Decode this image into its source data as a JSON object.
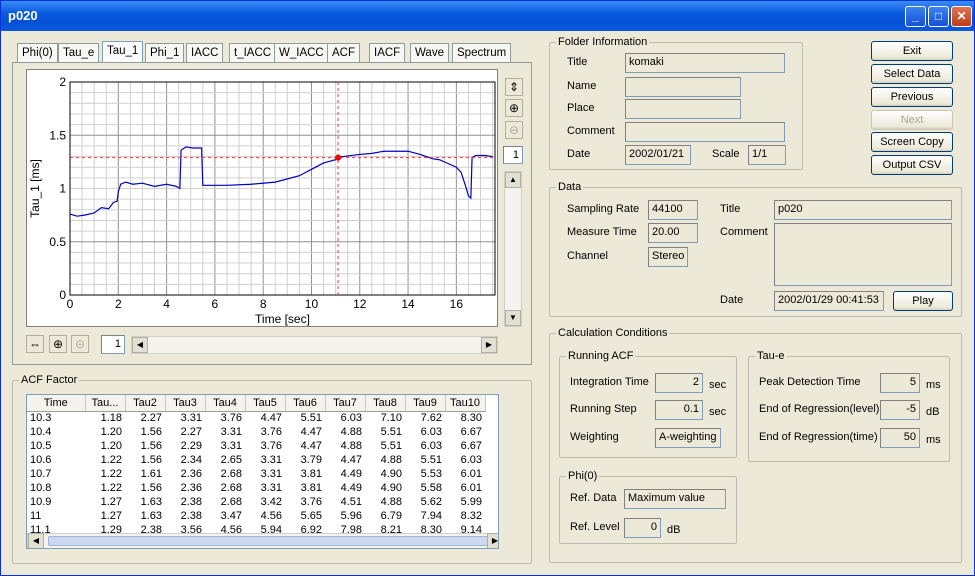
{
  "window": {
    "title": "p020"
  },
  "tabs": [
    "Phi(0)",
    "Tau_e",
    "Tau_1",
    "Phi_1",
    "IACC",
    "t_IACC",
    "W_IACC",
    "ACF",
    "IACF",
    "Wave",
    "Spectrum"
  ],
  "selected_tab": "Tau_1",
  "chart_data": {
    "type": "line",
    "xlabel": "Time [sec]",
    "ylabel": "Tau_1 [ms]",
    "xlim": [
      0,
      17.6
    ],
    "ylim": [
      0,
      2
    ],
    "xticks": [
      "0",
      "2",
      "4",
      "6",
      "8",
      "10",
      "12",
      "14",
      "16"
    ],
    "yticks": [
      "0",
      "0.5",
      "1",
      "1.5",
      "2"
    ],
    "grid": true,
    "cursor": {
      "x": 11.1,
      "y": 1.29
    },
    "series": [
      {
        "color": "#0000c0",
        "x": [
          0,
          0.3,
          0.6,
          1.0,
          1.3,
          1.6,
          1.8,
          1.95,
          2.0,
          2.1,
          2.3,
          2.6,
          3.0,
          3.5,
          4.0,
          4.4,
          4.55,
          4.6,
          4.8,
          5.1,
          5.45,
          5.5,
          6.5,
          7.5,
          8.5,
          9.5,
          10.0,
          10.5,
          11.0,
          11.1,
          11.3,
          12.0,
          12.5,
          13.0,
          13.5,
          14.0,
          14.5,
          15.0,
          15.3,
          15.7,
          16.0,
          16.2,
          16.4,
          16.5,
          16.6,
          16.65,
          16.8,
          17.2,
          17.5
        ],
        "y": [
          0.76,
          0.74,
          0.75,
          0.77,
          0.82,
          0.81,
          0.87,
          0.88,
          0.97,
          1.04,
          1.06,
          1.04,
          1.05,
          1.02,
          1.04,
          1.02,
          1.0,
          1.36,
          1.39,
          1.38,
          1.38,
          1.03,
          1.03,
          1.04,
          1.06,
          1.12,
          1.18,
          1.24,
          1.27,
          1.29,
          1.3,
          1.32,
          1.33,
          1.35,
          1.35,
          1.35,
          1.32,
          1.28,
          1.27,
          1.23,
          1.2,
          1.15,
          1.01,
          0.93,
          0.91,
          1.29,
          1.31,
          1.31,
          1.3
        ]
      }
    ]
  },
  "chart_controls": {
    "zoom_value_v": "1",
    "zoom_value_h": "1"
  },
  "folder_info": {
    "legend": "Folder Information",
    "title_label": "Title",
    "title_value": "komaki",
    "name_label": "Name",
    "name_value": "",
    "place_label": "Place",
    "place_value": "",
    "comment_label": "Comment",
    "comment_value": "",
    "date_label": "Date",
    "date_value": "2002/01/21",
    "scale_label": "Scale",
    "scale_value": "1/1"
  },
  "buttons": {
    "exit": "Exit",
    "select_data": "Select Data",
    "previous": "Previous",
    "next": "Next",
    "screen_copy": "Screen Copy",
    "output_csv": "Output CSV",
    "play": "Play"
  },
  "data_group": {
    "legend": "Data",
    "rate_label": "Sampling Rate",
    "rate_value": "44100",
    "time_label": "Measure Time",
    "time_value": "20.00",
    "channel_label": "Channel",
    "channel_value": "Stereo",
    "title_label": "Title",
    "title_value": "p020",
    "comment_label": "Comment",
    "comment_value": "",
    "date_label": "Date",
    "date_value": "2002/01/29 00:41:53"
  },
  "calc": {
    "legend": "Calculation Conditions",
    "running_acf": {
      "legend": "Running ACF",
      "integration_label": "Integration Time",
      "integration_value": "2",
      "integration_unit": "sec",
      "step_label": "Running Step",
      "step_value": "0.1",
      "step_unit": "sec",
      "weighting_label": "Weighting",
      "weighting_value": "A-weighting"
    },
    "tau_e": {
      "legend": "Tau-e",
      "peak_label": "Peak Detection Time",
      "peak_value": "5",
      "peak_unit": "ms",
      "end_level_label": "End of Regression(level)",
      "end_level_value": "-5",
      "end_level_unit": "dB",
      "end_time_label": "End of Regression(time)",
      "end_time_value": "50",
      "end_time_unit": "ms"
    },
    "phi0": {
      "legend": "Phi(0)",
      "ref_data_label": "Ref. Data",
      "ref_data_value": "Maximum value",
      "ref_level_label": "Ref. Level",
      "ref_level_value": "0",
      "ref_level_unit": "dB"
    }
  },
  "acf_factor": {
    "legend": "ACF Factor",
    "columns": [
      "Time",
      "Tau...",
      "Tau2",
      "Tau3",
      "Tau4",
      "Tau5",
      "Tau6",
      "Tau7",
      "Tau8",
      "Tau9",
      "Tau10"
    ],
    "rows": [
      [
        "10.3",
        "1.18",
        "2.27",
        "3.31",
        "3.76",
        "4.47",
        "5.51",
        "6.03",
        "7.10",
        "7.62",
        "8.30"
      ],
      [
        "10.4",
        "1.20",
        "1.56",
        "2.27",
        "3.31",
        "3.76",
        "4.47",
        "4.88",
        "5.51",
        "6.03",
        "6.67"
      ],
      [
        "10.5",
        "1.20",
        "1.56",
        "2.29",
        "3.31",
        "3.76",
        "4.47",
        "4.88",
        "5.51",
        "6.03",
        "6.67"
      ],
      [
        "10.6",
        "1.22",
        "1.56",
        "2.34",
        "2.65",
        "3.31",
        "3.79",
        "4.47",
        "4.88",
        "5.51",
        "6.03"
      ],
      [
        "10.7",
        "1.22",
        "1.61",
        "2.36",
        "2.68",
        "3.31",
        "3.81",
        "4.49",
        "4.90",
        "5.53",
        "6.01"
      ],
      [
        "10.8",
        "1.22",
        "1.56",
        "2.36",
        "2.68",
        "3.31",
        "3.81",
        "4.49",
        "4.90",
        "5.58",
        "6.01"
      ],
      [
        "10.9",
        "1.27",
        "1.63",
        "2.38",
        "2.68",
        "3.42",
        "3.76",
        "4.51",
        "4.88",
        "5.62",
        "5.99"
      ],
      [
        "11",
        "1.27",
        "1.63",
        "2.38",
        "3.47",
        "4.56",
        "5.65",
        "5.96",
        "6.79",
        "7.94",
        "8.32"
      ],
      [
        "11.1",
        "1.29",
        "2.38",
        "3.56",
        "4.56",
        "5.94",
        "6.92",
        "7.98",
        "8.21",
        "8.30",
        "9.14"
      ]
    ]
  }
}
